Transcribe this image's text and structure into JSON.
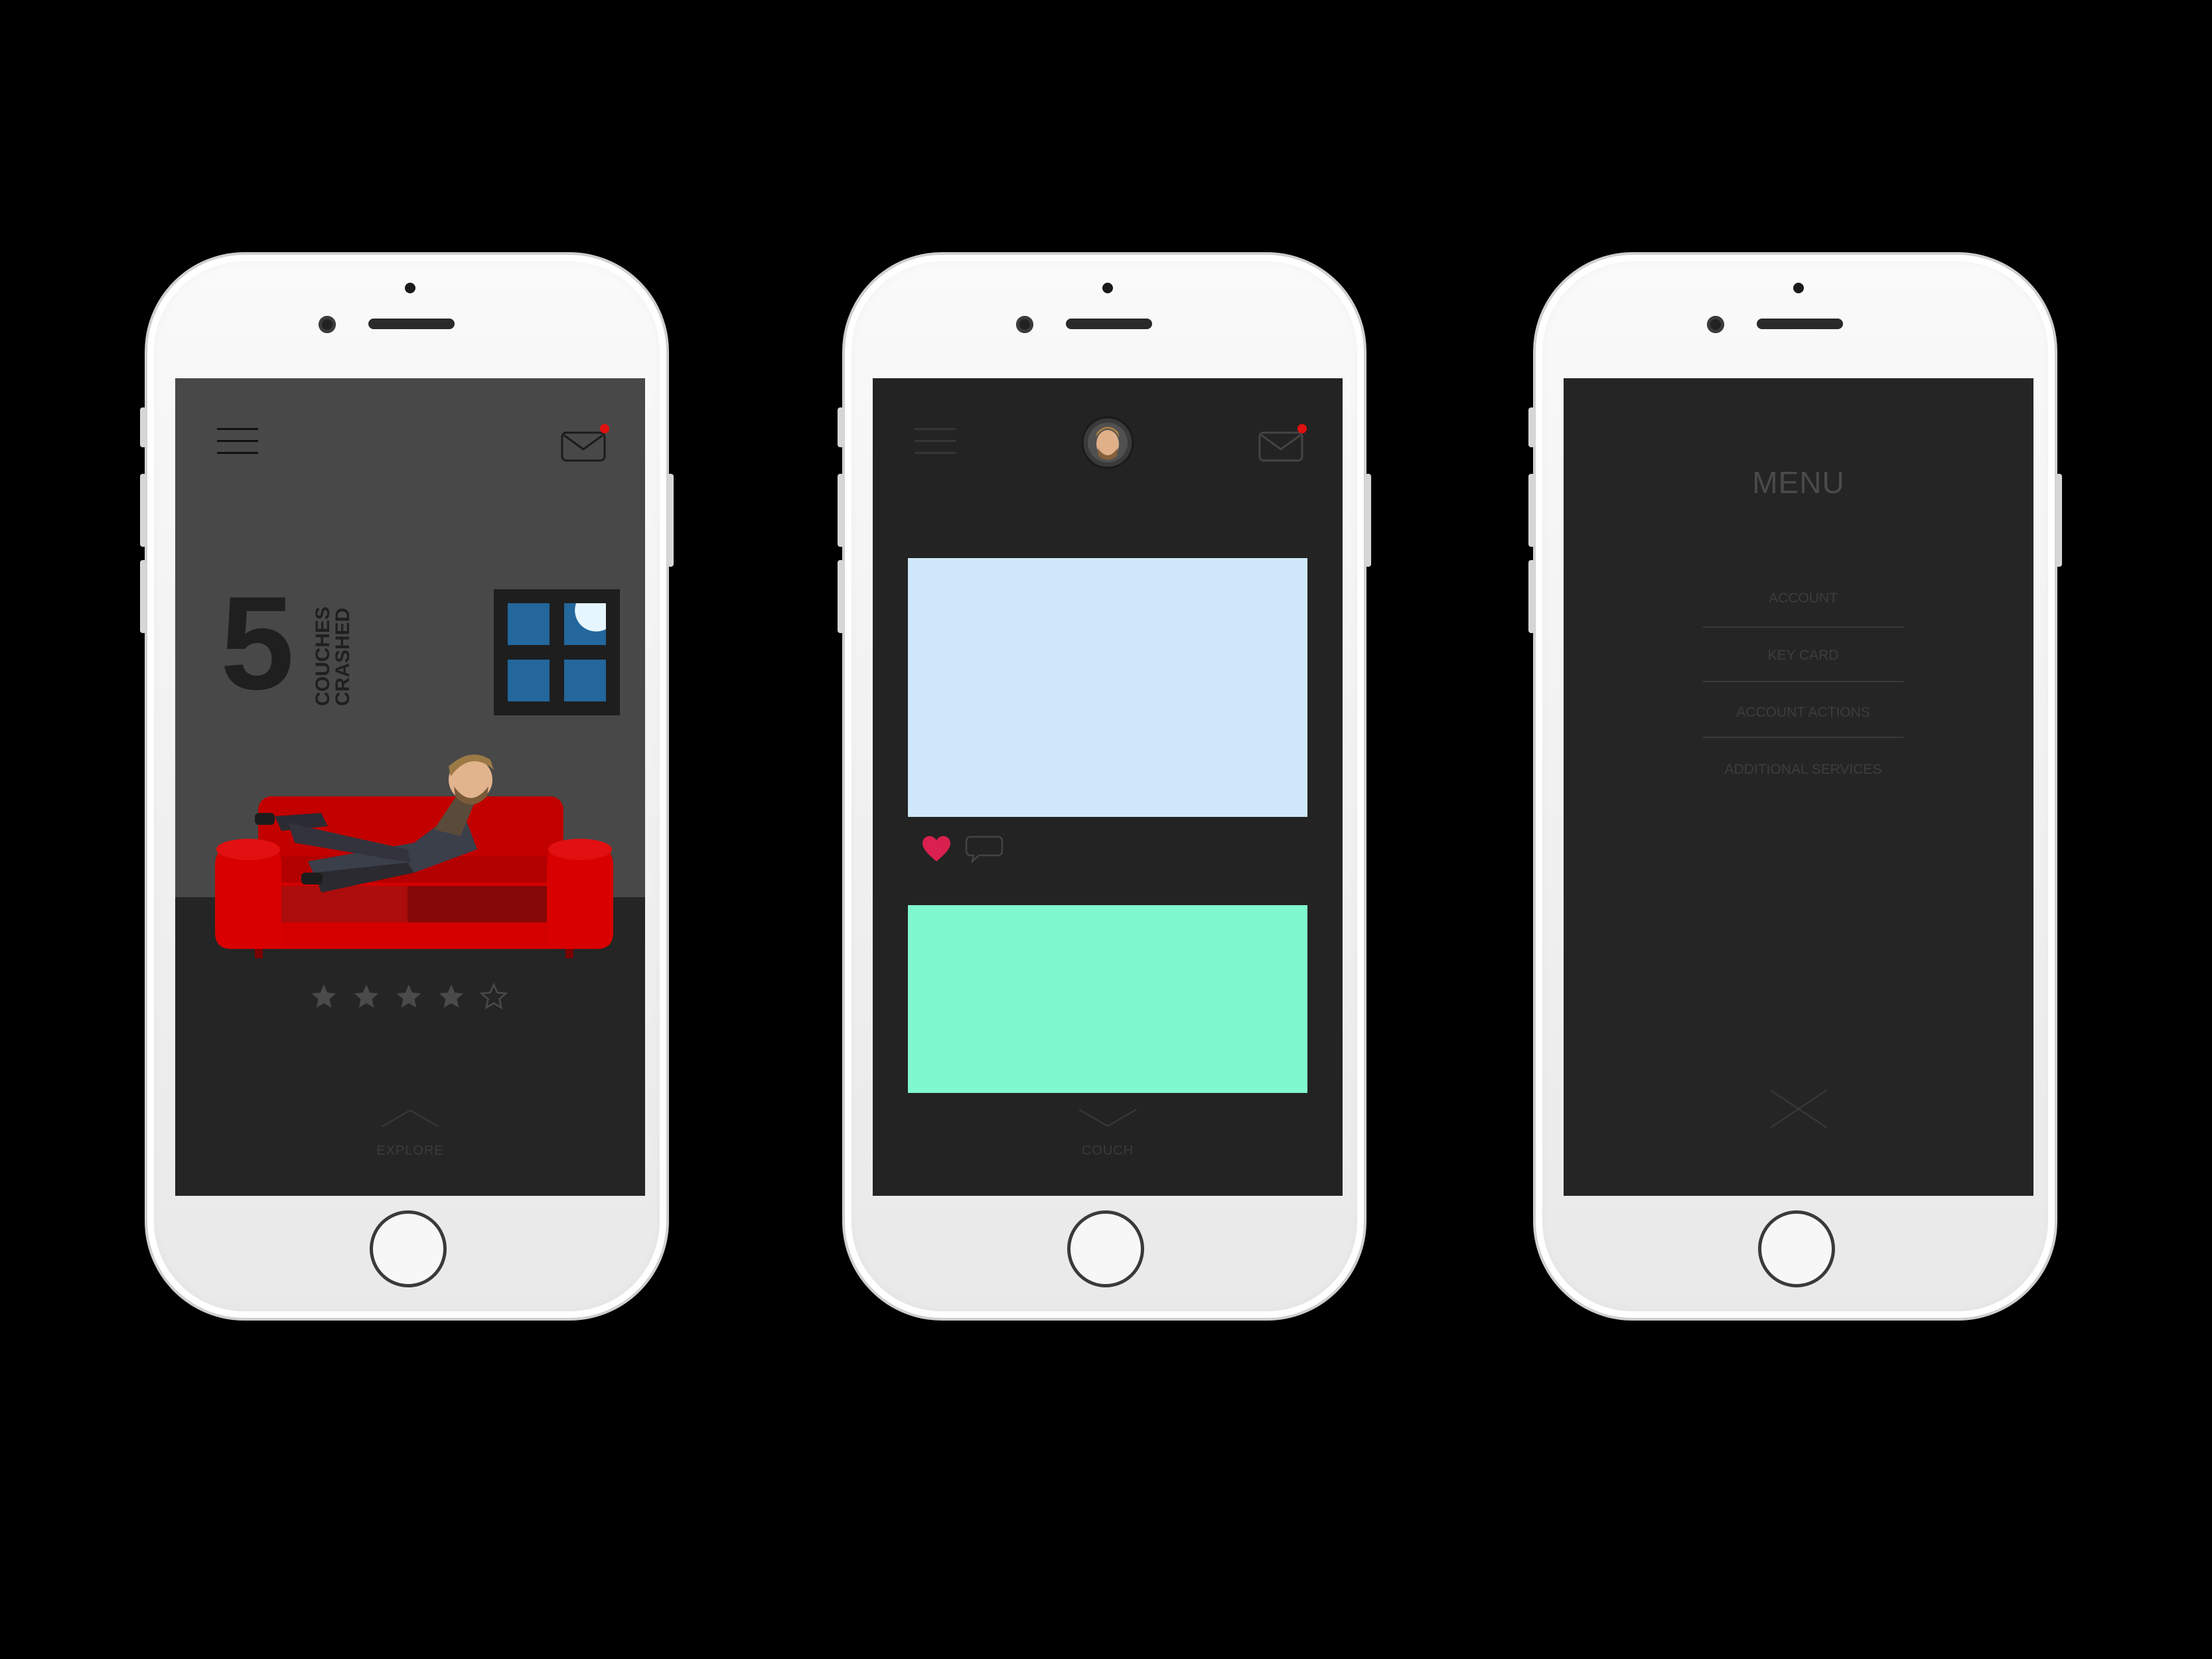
{
  "phones": [
    {
      "screen": "home",
      "header": {
        "menu_icon": "hamburger-icon",
        "mail_icon": "mail-icon",
        "has_notification": true
      },
      "stats": {
        "count": "5",
        "label_line1": "COUCHES",
        "label_line2": "CRASHED"
      },
      "rating": {
        "value": 4,
        "max": 5
      },
      "footer": {
        "label": "EXPLORE",
        "icon": "chevron-up-icon"
      }
    },
    {
      "screen": "feed",
      "header": {
        "menu_icon": "hamburger-icon",
        "avatar_icon": "avatar",
        "mail_icon": "mail-icon",
        "has_notification": true
      },
      "cards": [
        {
          "color": "#cfe8f9",
          "liked": true,
          "like_icon": "heart-icon",
          "comment_icon": "comment-icon"
        },
        {
          "color": "#80f8cf"
        }
      ],
      "footer": {
        "label": "COUCH",
        "icon": "chevron-down-icon"
      }
    },
    {
      "screen": "menu",
      "title": "MENU",
      "items": [
        "ACCOUNT",
        "KEY CARD",
        "ACCOUNT ACTIONS",
        "ADDITIONAL SERVICES"
      ],
      "close_icon": "close-icon"
    }
  ],
  "colors": {
    "notification": "#e01010",
    "couch": "#d40000",
    "window_pane": "#23679c",
    "heart": "#d9204e"
  }
}
